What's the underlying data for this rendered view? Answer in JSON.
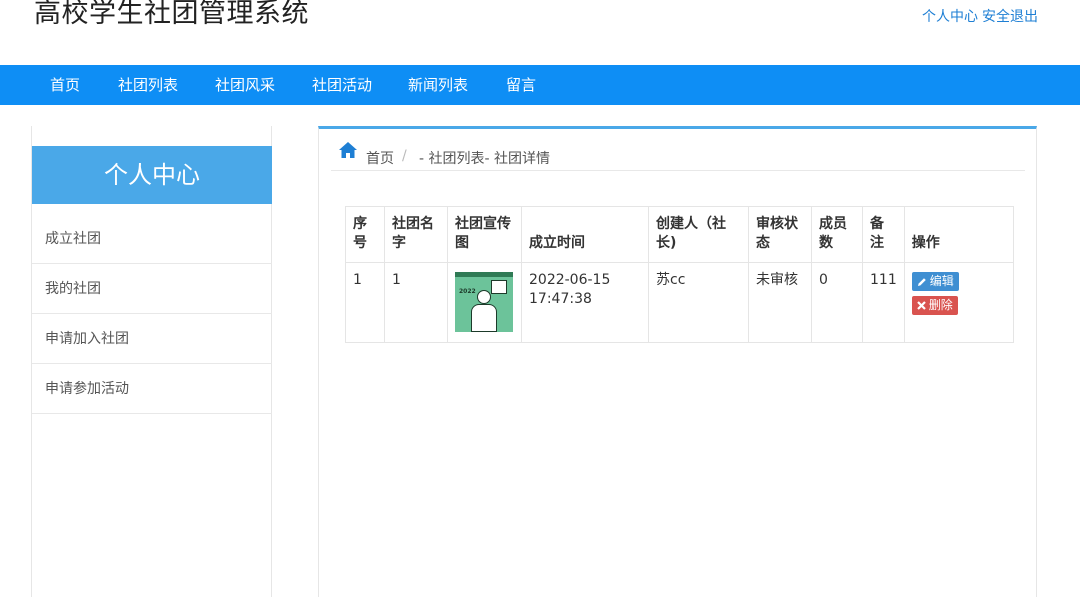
{
  "header": {
    "title": "高校学生社团管理系统",
    "links": [
      "个人中心",
      "安全退出"
    ]
  },
  "nav": [
    "首页",
    "社团列表",
    "社团风采",
    "社团活动",
    "新闻列表",
    "留言"
  ],
  "sidebar": {
    "title": "个人中心",
    "items": [
      "成立社团",
      "我的社团",
      "申请加入社团",
      "申请参加活动"
    ]
  },
  "breadcrumb": {
    "home": "首页",
    "separator": "/",
    "tail": "- 社团列表- 社团详情"
  },
  "table": {
    "headers": [
      "序号",
      "社团名字",
      "社团宣传图",
      "成立时间",
      "创建人（社长)",
      "审核状态",
      "成员数",
      "备注",
      "操作"
    ],
    "rows": [
      {
        "index": "1",
        "name": "1",
        "poster_year": "2022",
        "date": "2022-06-15",
        "time": "17:47:38",
        "creator": "苏cc",
        "status": "未审核",
        "members": "0",
        "note": "111",
        "edit_label": "编辑",
        "delete_label": "删除"
      }
    ]
  },
  "colors": {
    "nav_bg": "#0e8ef5",
    "sidebar_head_bg": "#4aa8e8",
    "link": "#1e7fd4",
    "edit_button": "#3f8fd2",
    "delete_button": "#d9534f"
  }
}
